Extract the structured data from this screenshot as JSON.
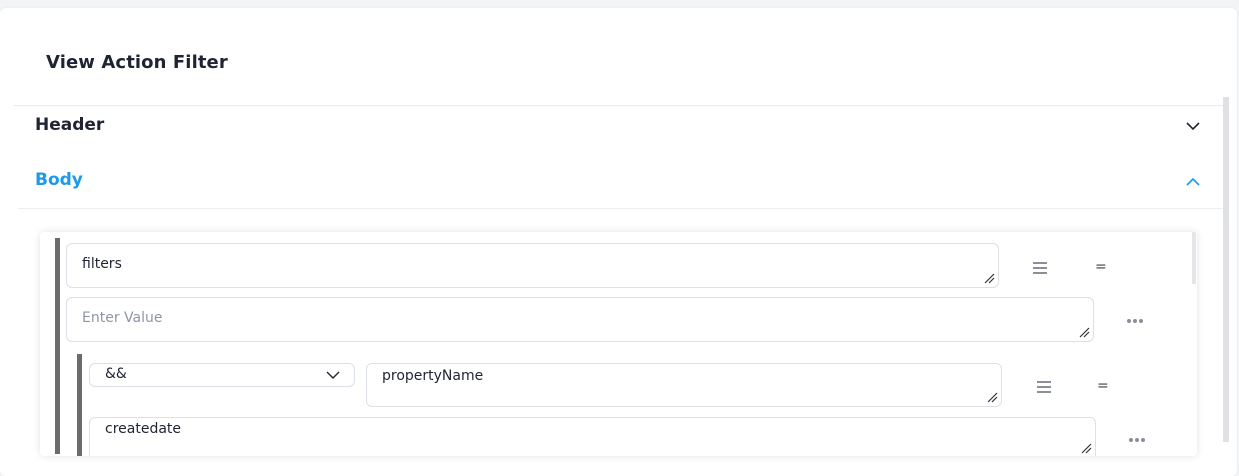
{
  "page": {
    "title": "View Action Filter"
  },
  "accordion": {
    "header_label": "Header",
    "body_label": "Body"
  },
  "colors": {
    "accent": "#1a9aea",
    "text": "#1f2433",
    "placeholder": "#8e96a6"
  },
  "filter": {
    "key_value": "filters",
    "operator_symbol": "=",
    "value_placeholder": "Enter Value",
    "nested": {
      "logic_selected": "&&",
      "key_value": "propertyName",
      "operator_symbol": "=",
      "value_value": "createdate"
    }
  },
  "icons": [
    "chevron-down-icon",
    "chevron-up-icon",
    "menu-icon",
    "more-icon",
    "resize-grip-icon"
  ]
}
